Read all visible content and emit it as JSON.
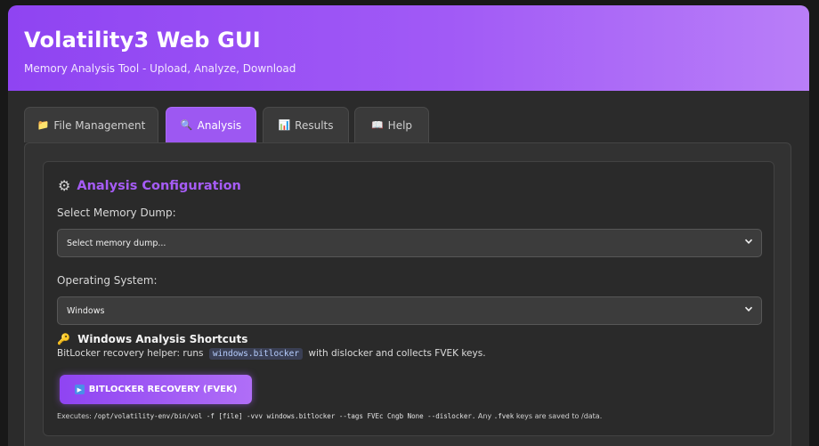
{
  "header": {
    "title": "Volatility3 Web GUI",
    "subtitle": "Memory Analysis Tool - Upload, Analyze, Download"
  },
  "tabs": [
    {
      "icon": "📁",
      "label": "File Management",
      "active": false
    },
    {
      "icon": "🔍",
      "label": "Analysis",
      "active": true
    },
    {
      "icon": "📊",
      "label": "Results",
      "active": false
    },
    {
      "icon": "📖",
      "label": "Help",
      "active": false
    }
  ],
  "config": {
    "title": "Analysis Configuration",
    "dump_label": "Select Memory Dump:",
    "dump_value": "Select memory dump...",
    "os_label": "Operating System:",
    "os_value": "Windows"
  },
  "shortcuts": {
    "title": "Windows Analysis Shortcuts",
    "desc_prefix": "BitLocker recovery helper: runs",
    "desc_code": "windows.bitlocker",
    "desc_suffix": "with dislocker and collects FVEK keys.",
    "button_label": "BITLOCKER RECOVERY (FVEK)",
    "exec_prefix": "Executes:",
    "exec_command": "/opt/volatility-env/bin/vol -f [file] -vvv windows.bitlocker --tags FVEc Cngb None --dislocker.",
    "exec_mid": "Any",
    "exec_ext": ".fvek",
    "exec_suffix": "keys are saved to /data."
  },
  "colors": {
    "accent": "#9d58f2",
    "accent_text": "#a65cf6"
  }
}
